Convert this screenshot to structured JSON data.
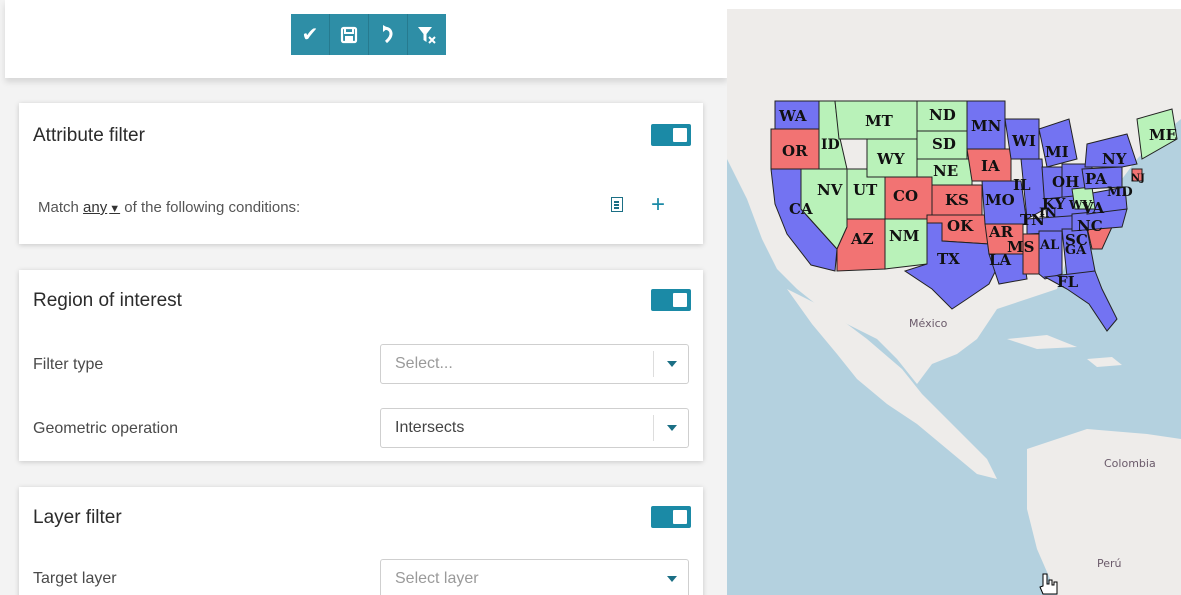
{
  "toolbar": {
    "buttons": [
      {
        "name": "apply",
        "icon": "check-icon",
        "glyph": "✔"
      },
      {
        "name": "save",
        "icon": "save-icon",
        "glyph": "🖫"
      },
      {
        "name": "reset",
        "icon": "undo-icon",
        "glyph": "↶"
      },
      {
        "name": "clear",
        "icon": "clear-filter-icon",
        "glyph": "⊽"
      }
    ],
    "accent_color": "#2e8ea6"
  },
  "attribute_filter": {
    "title": "Attribute filter",
    "match_prefix": "Match",
    "match_mode": "any",
    "match_suffix": "of the following conditions:",
    "enabled": true
  },
  "region_of_interest": {
    "title": "Region of interest",
    "enabled": true,
    "filter_type_label": "Filter type",
    "filter_type_placeholder": "Select...",
    "geometric_operation_label": "Geometric operation",
    "geometric_operation_value": "Intersects"
  },
  "layer_filter": {
    "title": "Layer filter",
    "enabled": true,
    "target_layer_label": "Target layer",
    "target_layer_placeholder": "Select layer"
  },
  "map": {
    "place_labels": [
      "México",
      "Colombia",
      "Perú"
    ],
    "state_colors": {
      "blue": "#7373f2",
      "green": "#b9f2b9",
      "red": "#f27373"
    },
    "states": [
      {
        "abbr": "WA",
        "color": "blue"
      },
      {
        "abbr": "OR",
        "color": "red"
      },
      {
        "abbr": "CA",
        "color": "blue"
      },
      {
        "abbr": "ID",
        "color": "green"
      },
      {
        "abbr": "NV",
        "color": "green"
      },
      {
        "abbr": "UT",
        "color": "green"
      },
      {
        "abbr": "AZ",
        "color": "red"
      },
      {
        "abbr": "MT",
        "color": "green"
      },
      {
        "abbr": "WY",
        "color": "green"
      },
      {
        "abbr": "CO",
        "color": "red"
      },
      {
        "abbr": "NM",
        "color": "green"
      },
      {
        "abbr": "ND",
        "color": "green"
      },
      {
        "abbr": "SD",
        "color": "green"
      },
      {
        "abbr": "NE",
        "color": "green"
      },
      {
        "abbr": "KS",
        "color": "red"
      },
      {
        "abbr": "OK",
        "color": "red"
      },
      {
        "abbr": "TX",
        "color": "blue"
      },
      {
        "abbr": "MN",
        "color": "blue"
      },
      {
        "abbr": "IA",
        "color": "red"
      },
      {
        "abbr": "MO",
        "color": "blue"
      },
      {
        "abbr": "AR",
        "color": "red"
      },
      {
        "abbr": "LA",
        "color": "blue"
      },
      {
        "abbr": "WI",
        "color": "blue"
      },
      {
        "abbr": "IL",
        "color": "blue"
      },
      {
        "abbr": "MI",
        "color": "blue"
      },
      {
        "abbr": "IN",
        "color": "blue"
      },
      {
        "abbr": "OH",
        "color": "blue"
      },
      {
        "abbr": "KY",
        "color": "blue"
      },
      {
        "abbr": "TN",
        "color": "blue"
      },
      {
        "abbr": "MS",
        "color": "red"
      },
      {
        "abbr": "AL",
        "color": "blue"
      },
      {
        "abbr": "GA",
        "color": "blue"
      },
      {
        "abbr": "FL",
        "color": "blue"
      },
      {
        "abbr": "SC",
        "color": "red"
      },
      {
        "abbr": "NC",
        "color": "blue"
      },
      {
        "abbr": "VA",
        "color": "blue"
      },
      {
        "abbr": "WV",
        "color": "green"
      },
      {
        "abbr": "PA",
        "color": "blue"
      },
      {
        "abbr": "NY",
        "color": "blue"
      },
      {
        "abbr": "ME",
        "color": "green"
      },
      {
        "abbr": "MD",
        "color": "blue"
      },
      {
        "abbr": "NJ",
        "color": "red"
      }
    ]
  }
}
